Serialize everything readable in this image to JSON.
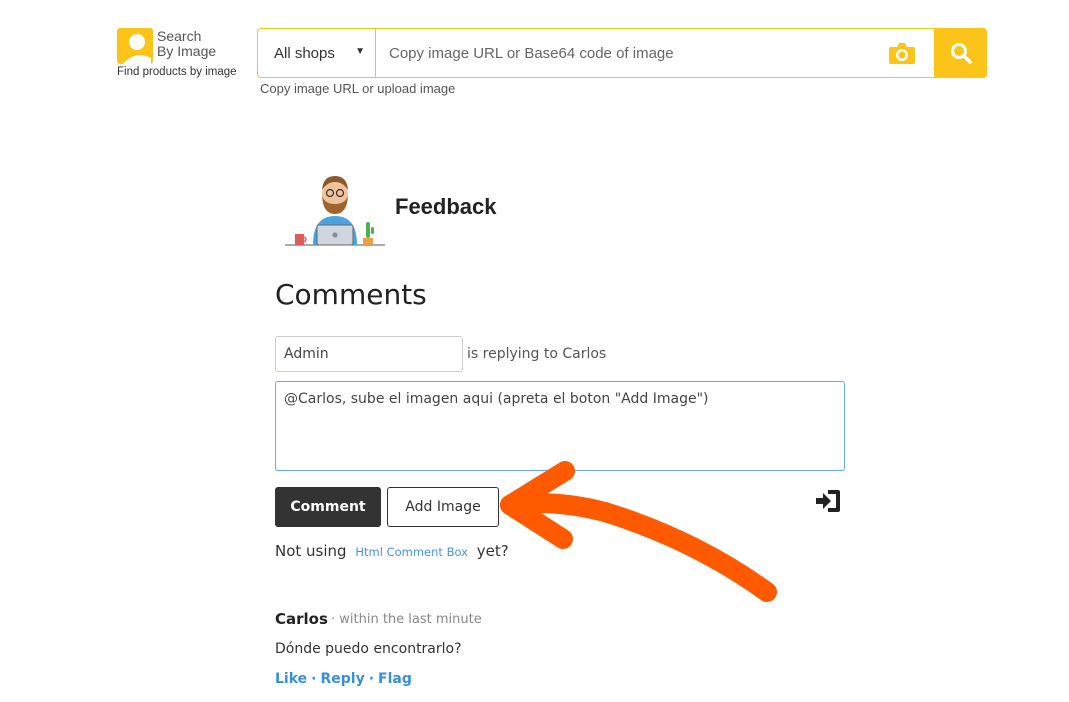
{
  "header": {
    "logo_line1": "Search",
    "logo_line2": "By Image",
    "logo_tagline": "Find products by image",
    "shop_select_value": "All shops",
    "url_placeholder": "Copy image URL or Base64 code of image",
    "hint": "Copy image URL or upload image",
    "accent_color": "#fcc419"
  },
  "feedback": {
    "title": "Feedback"
  },
  "comments": {
    "heading": "Comments",
    "name_value": "Admin",
    "replying_text": "is replying to Carlos",
    "comment_text": "@Carlos, sube el imagen aqui (apreta el boton \"Add Image\")",
    "comment_button": "Comment",
    "add_image_button": "Add Image",
    "not_using_prefix": "Not using",
    "not_using_link": "Html Comment Box",
    "not_using_suffix": "yet?"
  },
  "thread": [
    {
      "author": "Carlos",
      "time": "· within the last minute",
      "body": "Dónde puedo encontrarlo?",
      "actions": [
        "Like",
        "Reply",
        "Flag"
      ]
    }
  ],
  "annotation": {
    "arrow_color": "#ff5a00",
    "arrow_points_to": "add-image-button"
  }
}
